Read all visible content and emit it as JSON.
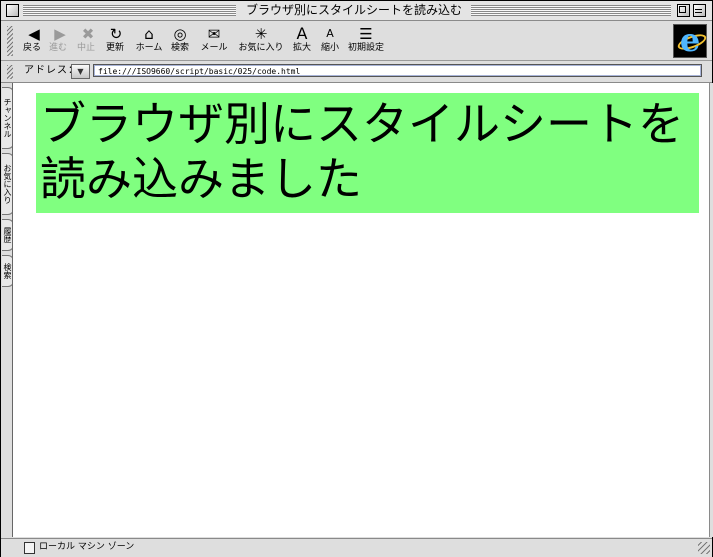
{
  "window": {
    "title": "ブラウザ別にスタイルシートを読み込む"
  },
  "toolbar": {
    "buttons": [
      {
        "label": "戻る",
        "icon": "back-arrow-icon",
        "glyph": "◀",
        "enabled": true
      },
      {
        "label": "進む",
        "icon": "forward-arrow-icon",
        "glyph": "▶",
        "enabled": false
      },
      {
        "label": "中止",
        "icon": "stop-icon",
        "glyph": "✖",
        "enabled": false
      },
      {
        "label": "更新",
        "icon": "refresh-icon",
        "glyph": "↻",
        "enabled": true
      },
      {
        "label": "ホーム",
        "icon": "home-icon",
        "glyph": "⌂",
        "enabled": true
      },
      {
        "label": "検索",
        "icon": "search-icon",
        "glyph": "◎",
        "enabled": true
      },
      {
        "label": "メール",
        "icon": "mail-icon",
        "glyph": "✉",
        "enabled": true
      },
      {
        "label": "お気に入り",
        "icon": "favorites-icon",
        "glyph": "✳",
        "enabled": true
      },
      {
        "label": "拡大",
        "icon": "font-larger-icon",
        "glyph": "A",
        "enabled": true
      },
      {
        "label": "縮小",
        "icon": "font-smaller-icon",
        "glyph": "A",
        "enabled": true
      },
      {
        "label": "初期設定",
        "icon": "preferences-icon",
        "glyph": "☰",
        "enabled": true
      }
    ],
    "logo": "e"
  },
  "address": {
    "label": "アドレス：",
    "url": "file:///ISO9660/script/basic/025/code.html"
  },
  "side_tabs": [
    "チャンネル",
    "お気に入り",
    "履歴",
    "検索"
  ],
  "page": {
    "heading": "ブラウザ別にスタイルシートを読み込みました",
    "heading_bg": "#80ff80"
  },
  "status": {
    "zone": "ローカル マシン ゾーン"
  }
}
